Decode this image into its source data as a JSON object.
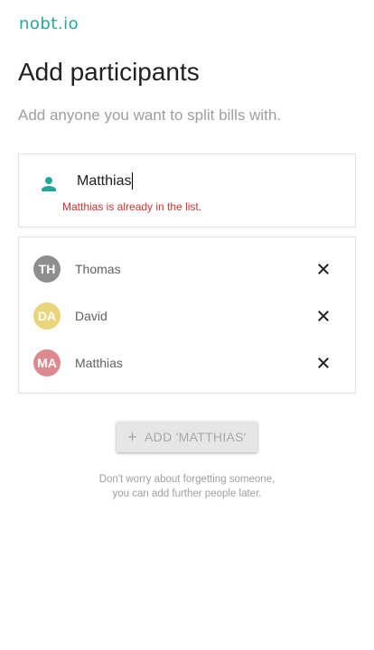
{
  "app": {
    "logo": "nobt.io"
  },
  "page": {
    "title": "Add participants",
    "subtitle": "Add anyone you want to split bills with."
  },
  "input": {
    "icon": "person-icon",
    "value": "Matthias",
    "error": "Matthias is already in the list."
  },
  "participants": [
    {
      "initials": "TH",
      "name": "Thomas",
      "color": "#8e8e8e"
    },
    {
      "initials": "DA",
      "name": "David",
      "color": "#ead57a"
    },
    {
      "initials": "MA",
      "name": "Matthias",
      "color": "#dc8a8f"
    }
  ],
  "add_button": {
    "label": "ADD 'MATTHIAS'",
    "icon": "plus-icon",
    "disabled": true
  },
  "hint": {
    "line1": "Don't worry about forgetting someone,",
    "line2": "you can add further people later."
  },
  "colors": {
    "brand": "#26a69a",
    "error": "#d32f2f"
  }
}
